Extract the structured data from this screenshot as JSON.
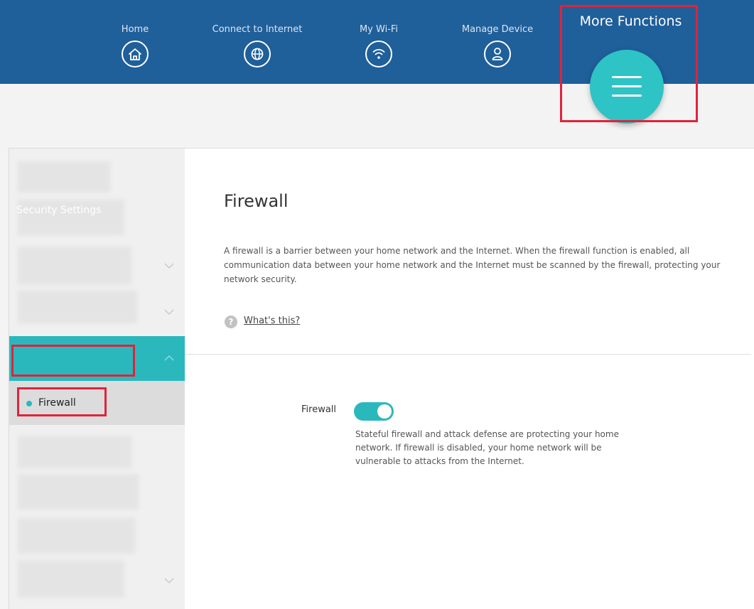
{
  "nav": {
    "items": [
      {
        "label": "Home",
        "icon": "home-icon"
      },
      {
        "label": "Connect to Internet",
        "icon": "globe-icon"
      },
      {
        "label": "My Wi-Fi",
        "icon": "wifi-icon"
      },
      {
        "label": "Manage Device",
        "icon": "user-icon"
      }
    ],
    "more_functions": {
      "label": "More Functions",
      "icon": "hamburger-menu-icon"
    }
  },
  "sidebar": {
    "active_group": "Security Settings",
    "active_item": "Firewall"
  },
  "main": {
    "title": "Firewall",
    "description": "A firewall is a barrier between your home network and the Internet. When the firewall function is enabled, all communication data between your home network and the Internet must be scanned by the firewall, protecting your network security.",
    "help_link": "What's this?",
    "firewall_label": "Firewall",
    "firewall_enabled": true,
    "firewall_note": "Stateful firewall and attack defense are protecting your home network. If firewall is disabled, your home network will be vulnerable to attacks from the Internet."
  },
  "colors": {
    "nav_bar": "#1f5f9a",
    "accent_teal": "#2ab8bd",
    "highlight_red": "#e0233b"
  }
}
